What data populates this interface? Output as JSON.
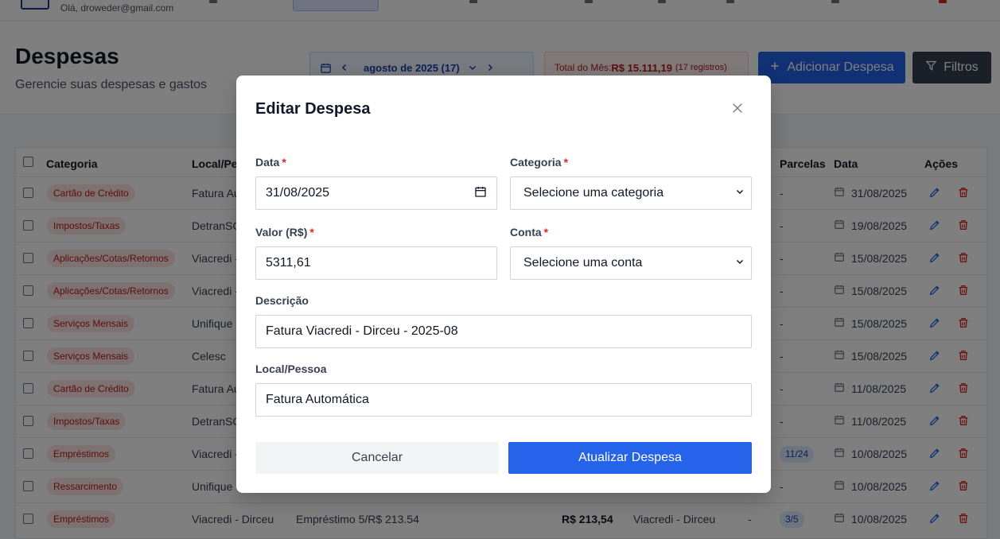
{
  "topbar": {
    "greeting": "Olá, droweder@gmail.com"
  },
  "header": {
    "title": "Despesas",
    "subtitle": "Gerencie suas despesas e gastos",
    "month_label": "agosto de 2025 (17)",
    "total_label": "Total do Mês:",
    "total_amount": "R$ 15.111,19",
    "total_count": "(17 registros)",
    "add_button": "Adicionar Despesa",
    "filter_button": "Filtros"
  },
  "table": {
    "headers": {
      "categoria": "Categoria",
      "local": "Local/Pessoa",
      "parcelas": "Parcelas",
      "data": "Data",
      "acoes": "Ações"
    },
    "rows": [
      {
        "categoria": "Cartão de Crédito",
        "local": "Fatura Automática",
        "parcelas": "-",
        "data": "31/08/2025"
      },
      {
        "categoria": "Impostos/Taxas",
        "local": "DetranSC",
        "parcelas": "-",
        "data": "19/08/2025"
      },
      {
        "categoria": "Aplicações/Cotas/Retornos",
        "local": "Viacredi - Dirceu",
        "parcelas": "-",
        "data": "15/08/2025"
      },
      {
        "categoria": "Aplicações/Cotas/Retornos",
        "local": "Viacredi - Dirceu",
        "parcelas": "-",
        "data": "15/08/2025"
      },
      {
        "categoria": "Serviços Mensais",
        "local": "Unifique",
        "parcelas": "-",
        "data": "15/08/2025"
      },
      {
        "categoria": "Serviços Mensais",
        "local": "Celesc",
        "parcelas": "-",
        "data": "15/08/2025"
      },
      {
        "categoria": "Cartão de Crédito",
        "local": "Fatura Automática",
        "parcelas": "-",
        "data": "11/08/2025"
      },
      {
        "categoria": "Impostos/Taxas",
        "local": "DetranSC",
        "parcelas": "-",
        "data": "11/08/2025"
      },
      {
        "categoria": "Empréstimos",
        "local": "Viacredi - Dirceu",
        "parcelas": "11/24",
        "data": "10/08/2025"
      },
      {
        "categoria": "Ressarcimento",
        "local": "Unifique",
        "parcelas": "-",
        "data": "10/08/2025"
      },
      {
        "categoria": "Empréstimos",
        "local": "Viacredi - Dirceu",
        "descricao": "Empréstimo 5/R$ 213.54",
        "valor": "R$ 213,54",
        "conta": "Viacredi - Dirceu",
        "extra": "-",
        "parcelas": "3/5",
        "data": "10/08/2025"
      }
    ]
  },
  "modal": {
    "title": "Editar Despesa",
    "data_label": "Data",
    "data_value": "31/08/2025",
    "categoria_label": "Categoria",
    "categoria_value": "Selecione uma categoria",
    "valor_label": "Valor (R$)",
    "valor_value": "5311,61",
    "conta_label": "Conta",
    "conta_value": "Selecione uma conta",
    "descricao_label": "Descrição",
    "descricao_value": "Fatura Viacredi - Dirceu - 2025-08",
    "local_label": "Local/Pessoa",
    "local_value": "Fatura Automática",
    "required_mark": "*",
    "cancel_button": "Cancelar",
    "update_button": "Atualizar Despesa"
  },
  "colors": {
    "primary": "#2563eb",
    "danger": "#dc2626",
    "badge_bg": "#fde2e2",
    "badge_text": "#b91c1c",
    "dark_button": "#374151"
  }
}
